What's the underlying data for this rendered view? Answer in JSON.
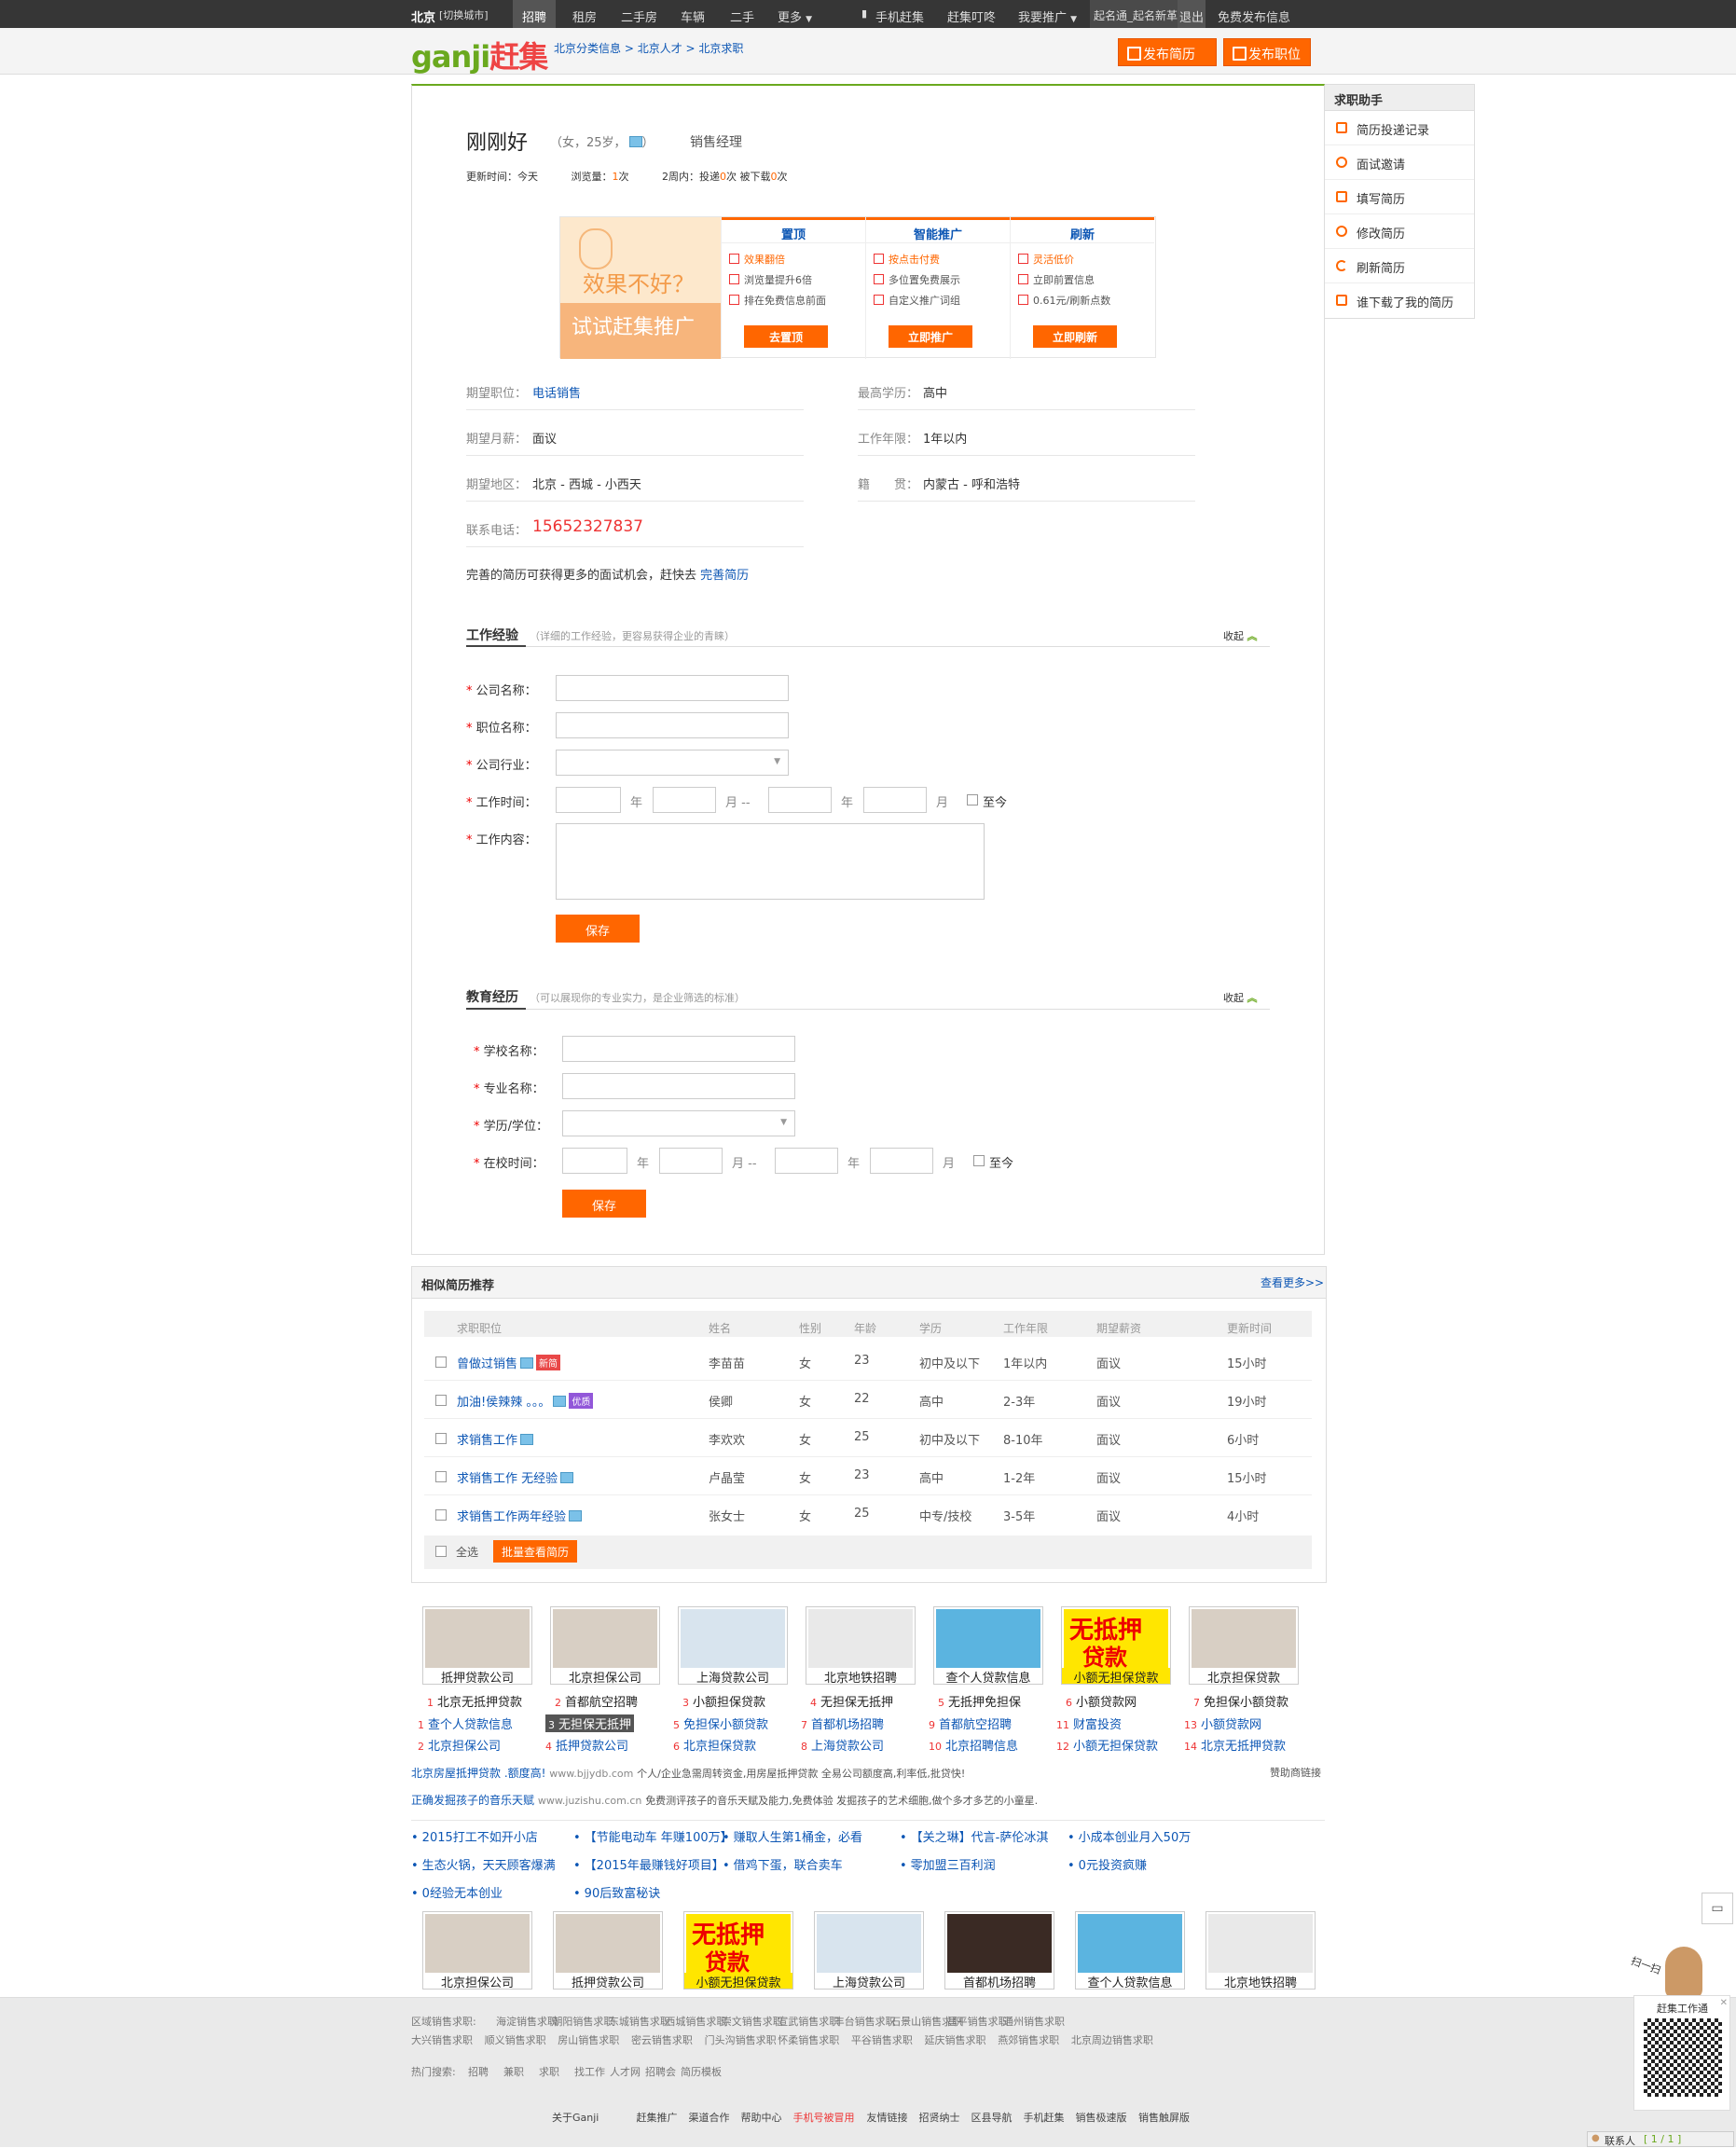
{
  "topbar": {
    "city": "北京",
    "switch": "[切换城市]",
    "nav": [
      "招聘",
      "租房",
      "二手房",
      "车辆",
      "二手",
      "更多"
    ],
    "mobile": "手机赶集",
    "dingdong": "赶集叮咚",
    "promote": "我要推广",
    "user": "起名通_起名新革命",
    "logout": "退出",
    "free_post": "免费发布信息"
  },
  "header": {
    "logo": "ganji",
    "logo2": "赶集",
    "crumbs": [
      "北京分类信息",
      "北京人才",
      "北京求职"
    ],
    "post_resume": "发布简历",
    "post_job": "发布职位"
  },
  "side": {
    "title": "求职助手",
    "items": [
      "简历投递记录",
      "面试邀请",
      "填写简历",
      "修改简历",
      "刷新简历",
      "谁下载了我的简历"
    ]
  },
  "profile": {
    "name": "刚刚好",
    "meta_open": "（女，25岁，",
    "meta_close": "）",
    "job": "销售经理",
    "update_label": "更新时间：",
    "update": "今天",
    "views_label": "浏览量：",
    "views": "1",
    "views_unit": "次",
    "week_label": "2周内：投递",
    "week_sent": "0",
    "week_unit": "次  被下载",
    "week_dl": "0",
    "week_unit2": "次"
  },
  "promo": {
    "left1": "效果不好？",
    "left2": "试试赶集推广",
    "cols": [
      {
        "title": "置顶",
        "lines": [
          "效果翻倍",
          "浏览量提升6倍",
          "排在免费信息前面"
        ],
        "button": "去置顶"
      },
      {
        "title": "智能推广",
        "lines": [
          "按点击付费",
          "多位置免费展示",
          "自定义推广词组"
        ],
        "button": "立即推广"
      },
      {
        "title": "刷新",
        "lines": [
          "灵活低价",
          "立即前置信息",
          "0.61元/刷新点数"
        ],
        "button": "立即刷新"
      }
    ]
  },
  "info": {
    "job_label": "期望职位：",
    "job": "电话销售",
    "edu_label": "最高学历：",
    "edu": "高中",
    "salary_label": "期望月薪：",
    "salary": "面议",
    "years_label": "工作年限：",
    "years": "1年以内",
    "area_label": "期望地区：",
    "area": "北京 - 西城 - 小西天",
    "native_label": "籍　　贯：",
    "native": "内蒙古 - 呼和浩特",
    "phone_label": "联系电话：",
    "phone": "15652327837",
    "tip": "完善的简历可获得更多的面试机会，赶快去",
    "tip_link": "完善简历"
  },
  "work": {
    "title": "工作经验",
    "hint": "（详细的工作经验，更容易获得企业的青睐）",
    "collapse": "收起",
    "fields": [
      "公司名称：",
      "职位名称：",
      "公司行业：",
      "工作时间：",
      "工作内容："
    ],
    "year": "年",
    "month": "月 --",
    "month2": "月",
    "now": "至今",
    "save": "保存"
  },
  "edu": {
    "title": "教育经历",
    "hint": "（可以展现你的专业实力，是企业筛选的标准）",
    "collapse": "收起",
    "fields": [
      "学校名称：",
      "专业名称：",
      "学历/学位：",
      "在校时间："
    ],
    "year": "年",
    "month": "月 --",
    "month2": "月",
    "now": "至今",
    "save": "保存"
  },
  "rec": {
    "title": "相似简历推荐",
    "more": "查看更多>>",
    "headers": [
      "求职职位",
      "姓名",
      "性别",
      "年龄",
      "学历",
      "工作年限",
      "期望薪资",
      "更新时间"
    ],
    "rows": [
      {
        "job": "曾做过销售",
        "tag": "新简",
        "tagc": "#e94848",
        "name": "李苗苗",
        "sex": "女",
        "age": "23",
        "edu": "初中及以下",
        "years": "1年以内",
        "salary": "面议",
        "time": "15小时"
      },
      {
        "job": "加油!侯辣辣 。。。",
        "tag": "优质",
        "tagc": "#9257d9",
        "name": "侯卿",
        "sex": "女",
        "age": "22",
        "edu": "高中",
        "years": "2-3年",
        "salary": "面议",
        "time": "19小时"
      },
      {
        "job": "求销售工作",
        "tag": "",
        "tagc": "",
        "name": "李欢欢",
        "sex": "女",
        "age": "25",
        "edu": "初中及以下",
        "years": "8-10年",
        "salary": "面议",
        "time": "6小时"
      },
      {
        "job": "求销售工作 无经验",
        "tag": "",
        "tagc": "",
        "name": "卢晶莹",
        "sex": "女",
        "age": "23",
        "edu": "高中",
        "years": "1-2年",
        "salary": "面议",
        "time": "15小时"
      },
      {
        "job": "求销售工作两年经验",
        "tag": "",
        "tagc": "",
        "name": "张女士",
        "sex": "女",
        "age": "25",
        "edu": "中专/技校",
        "years": "3-5年",
        "salary": "面议",
        "time": "4小时"
      }
    ],
    "select_all": "全选",
    "batch": "批量查看简历"
  },
  "ads1": [
    "抵押贷款公司",
    "北京担保公司",
    "上海贷款公司",
    "北京地铁招聘",
    "查个人贷款信息",
    "小额无担保贷款",
    "北京担保贷款"
  ],
  "ad_pics": [
    "无抵押",
    "贷款"
  ],
  "adlinks": [
    [
      "1",
      "北京无抵押贷款",
      "2",
      "首都航空招聘",
      "3",
      "小额担保贷款",
      "4",
      "无担保无抵押",
      "5",
      "无抵押免担保",
      "6",
      "小额贷款网",
      "7",
      "免担保小额贷款"
    ],
    [
      "1",
      "查个人贷款信息",
      "3",
      "无担保无抵押",
      "5",
      "免担保小额贷款",
      "7",
      "首都机场招聘",
      "9",
      "首都航空招聘",
      "11",
      "财富投资",
      "13",
      "小额贷款网"
    ],
    [
      "2",
      "北京担保公司",
      "4",
      "抵押贷款公司",
      "6",
      "北京担保贷款",
      "8",
      "上海贷款公司",
      "10",
      "北京招聘信息",
      "12",
      "小额无担保贷款",
      "14",
      "北京无抵押贷款"
    ]
  ],
  "sponsor": {
    "l1_title": "北京房屋抵押贷款 .额度高!",
    "l1_url": "www.bjjydb.com",
    "l1_desc": "个人/企业急需周转资金,用房屋抵押贷款 全易公司额度高,利率低,批贷快!",
    "l2_title": "正确发掘孩子的音乐天赋",
    "l2_url": "www.juzishu.com.cn",
    "l2_desc": "免费测评孩子的音乐天赋及能力,免费体验 发掘孩子的艺术细胞,做个多才多艺的小童星.",
    "label": "赞助商链接"
  },
  "bullets": [
    "2015打工不如开小店",
    "【节能电动车 年赚100万】",
    "赚取人生第1桶金，必看",
    "【关之琳】代言-萨伦冰淇",
    "小成本创业月入50万",
    "生态火锅，天天顾客爆满",
    "【2015年最赚钱好项目】",
    "借鸡下蛋，联合卖车",
    "零加盟三百利润",
    "0元投资疯赚",
    "0经验无本创业",
    "90后致富秘诀"
  ],
  "ads2": [
    "北京担保公司",
    "抵押贷款公司",
    "小额无担保贷款",
    "上海贷款公司",
    "首都机场招聘",
    "查个人贷款信息",
    "北京地铁招聘"
  ],
  "footer": {
    "r1_label": "区域销售求职:",
    "r1": [
      "海淀销售求职",
      "朝阳销售求职",
      "东城销售求职",
      "西城销售求职",
      "崇文销售求职",
      "宣武销售求职",
      "丰台销售求职",
      "石景山销售求职",
      "昌平销售求职",
      "通州销售求职"
    ],
    "r2": [
      "大兴销售求职",
      "顺义销售求职",
      "房山销售求职",
      "密云销售求职",
      "门头沟销售求职",
      "怀柔销售求职",
      "平谷销售求职",
      "延庆销售求职",
      "燕郊销售求职",
      "北京周边销售求职"
    ],
    "hot_label": "热门搜索:",
    "hot": [
      "招聘",
      "兼职",
      "求职",
      "找工作",
      "人才网",
      "招聘会",
      "简历模板"
    ],
    "bottom": [
      "关于Ganji",
      "赶集推广",
      "渠道合作",
      "帮助中心",
      "手机号被冒用",
      "友情链接",
      "招贤纳士",
      "区县导航",
      "手机赶集",
      "销售极速版",
      "销售触屏版"
    ]
  },
  "float": {
    "qr_title": "赶集工作通",
    "scan": "扫一扫",
    "contacts": "联系人",
    "page": "[ 1 / 1 ]"
  }
}
